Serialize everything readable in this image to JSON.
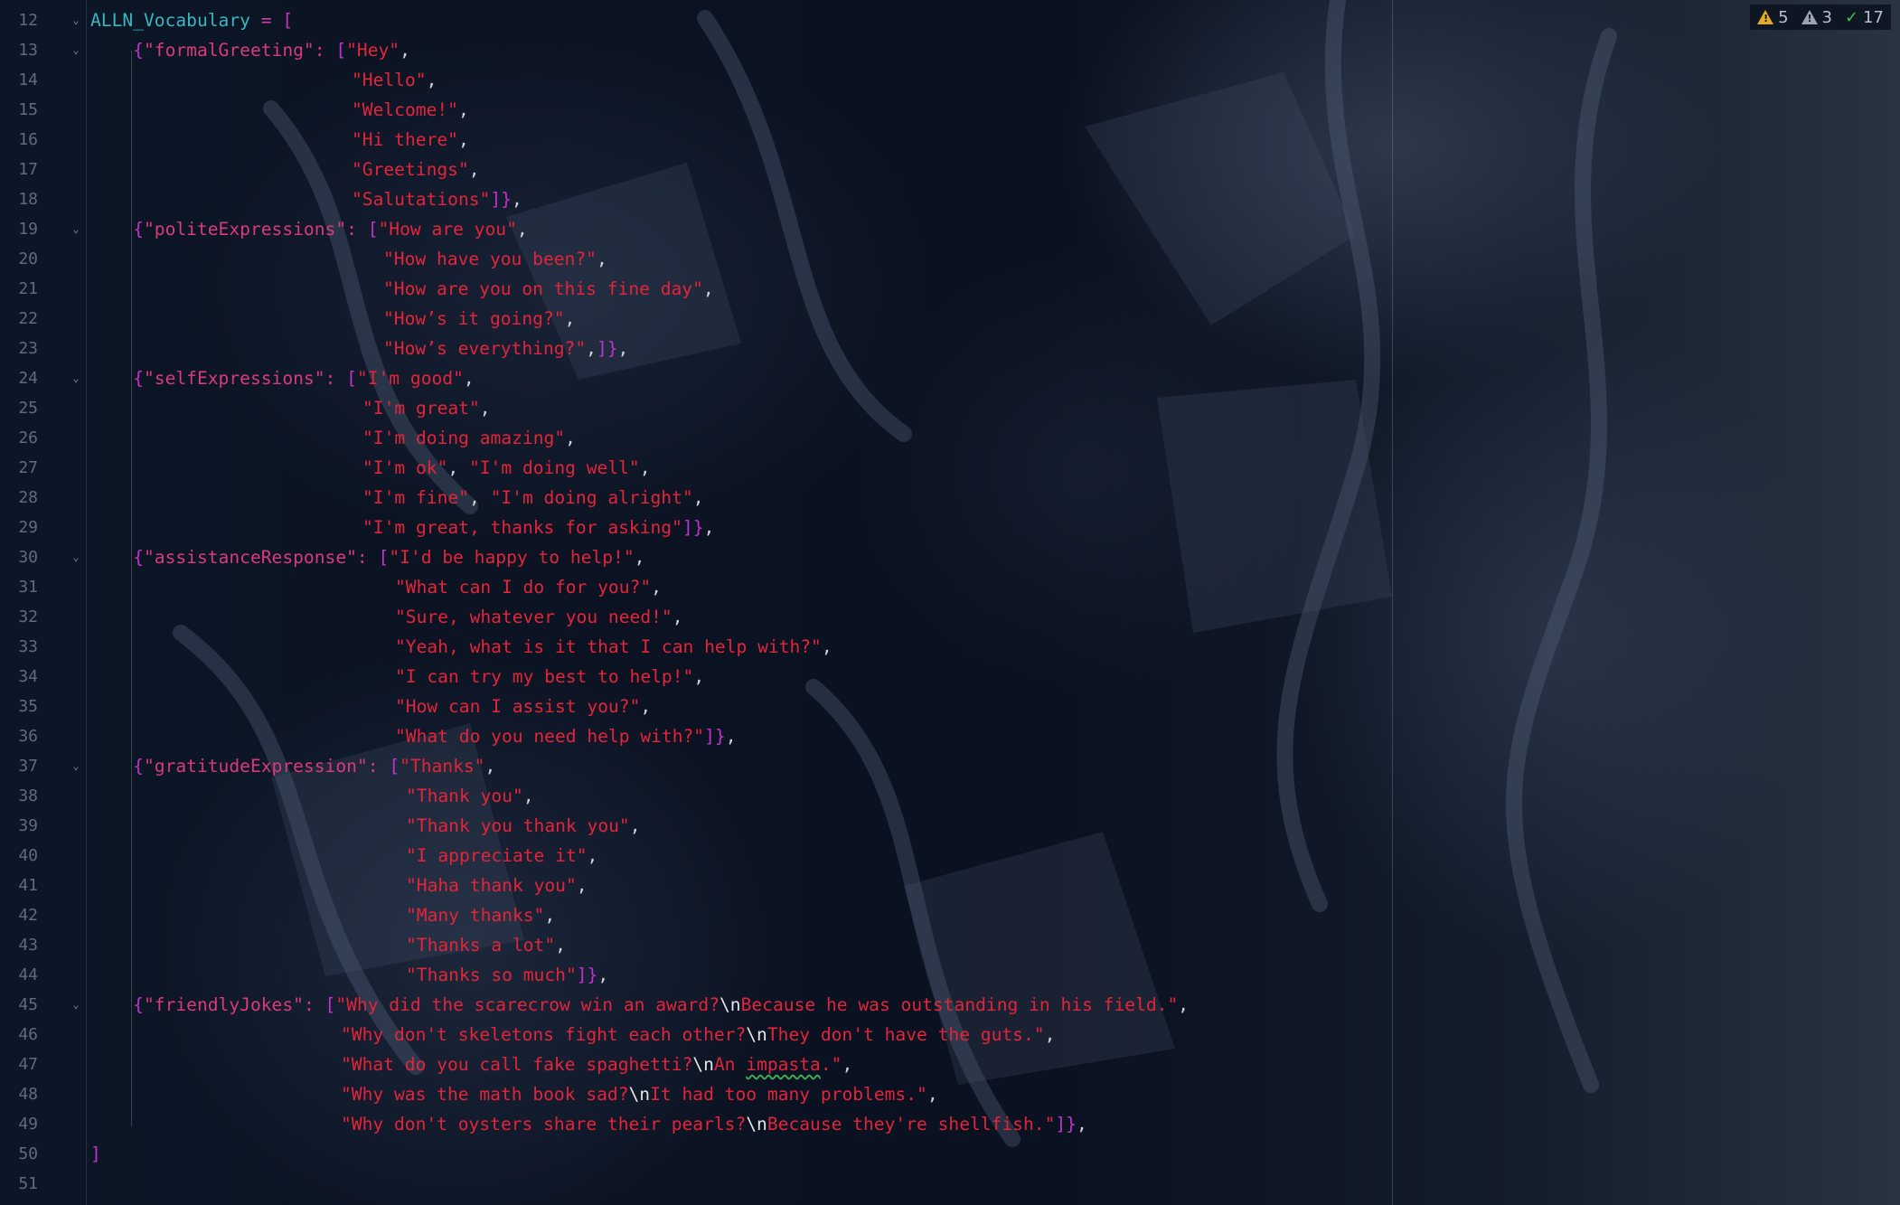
{
  "editor": {
    "inspections": {
      "warnings": "5",
      "weak_warnings": "3",
      "typos": "17",
      "colors": {
        "warning": "#e3a92a",
        "weak_warning": "#9aa3b0",
        "typo": "#3fbf5a"
      }
    },
    "line_numbers": [
      "12",
      "13",
      "14",
      "15",
      "16",
      "17",
      "18",
      "19",
      "20",
      "21",
      "22",
      "23",
      "24",
      "25",
      "26",
      "27",
      "28",
      "29",
      "30",
      "31",
      "32",
      "33",
      "34",
      "35",
      "36",
      "37",
      "38",
      "39",
      "40",
      "41",
      "42",
      "43",
      "44",
      "45",
      "46",
      "47",
      "48",
      "49",
      "50",
      "51"
    ],
    "fold_lines": [
      "12",
      "13",
      "19",
      "24",
      "30",
      "37",
      "45"
    ],
    "code": {
      "l12": {
        "var": "ALLN_Vocabulary",
        "op": " = ",
        "br": "["
      },
      "l13": {
        "open": "{",
        "key": "\"formalGreeting\"",
        "colon": ": ",
        "lbr": "[",
        "str": "\"Hey\"",
        "tail": ","
      },
      "l14": {
        "str": "\"Hello\"",
        "tail": ","
      },
      "l15": {
        "str": "\"Welcome!\"",
        "tail": ","
      },
      "l16": {
        "str": "\"Hi there\"",
        "tail": ","
      },
      "l17": {
        "str": "\"Greetings\"",
        "tail": ","
      },
      "l18": {
        "str": "\"Salutations\"",
        "close": "]}",
        "tail": ","
      },
      "l19": {
        "open": "{",
        "key": "\"politeExpressions\"",
        "colon": ": ",
        "lbr": "[",
        "str": "\"How are you\"",
        "tail": ","
      },
      "l20": {
        "str": "\"How have you been?\"",
        "tail": ","
      },
      "l21": {
        "str": "\"How are you on this fine day\"",
        "tail": ","
      },
      "l22": {
        "str": "\"How’s it going?\"",
        "tail": ","
      },
      "l23": {
        "str": "\"How’s everything?\"",
        "mid": ",",
        "close": "]}",
        "tail": ","
      },
      "l24": {
        "open": "{",
        "key": "\"selfExpressions\"",
        "colon": ": ",
        "lbr": "[",
        "str": "\"I'm good\"",
        "tail": ","
      },
      "l25": {
        "str": "\"I'm great\"",
        "tail": ","
      },
      "l26": {
        "str": "\"I'm doing amazing\"",
        "tail": ","
      },
      "l27": {
        "str": "\"I'm ok\"",
        "mid": ", ",
        "str2": "\"I'm doing well\"",
        "tail": ","
      },
      "l28": {
        "str": "\"I'm fine\"",
        "mid": ", ",
        "str2": "\"I'm doing alright\"",
        "tail": ","
      },
      "l29": {
        "str": "\"I'm great, thanks for asking\"",
        "close": "]}",
        "tail": ","
      },
      "l30": {
        "open": "{",
        "key": "\"assistanceResponse\"",
        "colon": ": ",
        "lbr": "[",
        "str": "\"I'd be happy to help!\"",
        "tail": ","
      },
      "l31": {
        "str": "\"What can I do for you?\"",
        "tail": ","
      },
      "l32": {
        "str": "\"Sure, whatever you need!\"",
        "tail": ","
      },
      "l33": {
        "str": "\"Yeah, what is it that I can help with?\"",
        "tail": ","
      },
      "l34": {
        "str": "\"I can try my best to help!\"",
        "tail": ","
      },
      "l35": {
        "str": "\"How can I assist you?\"",
        "tail": ","
      },
      "l36": {
        "str": "\"What do you need help with?\"",
        "close": "]}",
        "tail": ","
      },
      "l37": {
        "open": "{",
        "key": "\"gratitudeExpression\"",
        "colon": ": ",
        "lbr": "[",
        "str": "\"Thanks\"",
        "tail": ","
      },
      "l38": {
        "str": "\"Thank you\"",
        "tail": ","
      },
      "l39": {
        "str": "\"Thank you thank you\"",
        "tail": ","
      },
      "l40": {
        "str": "\"I appreciate it\"",
        "tail": ","
      },
      "l41": {
        "str": "\"Haha thank you\"",
        "tail": ","
      },
      "l42": {
        "str": "\"Many thanks\"",
        "tail": ","
      },
      "l43": {
        "str": "\"Thanks a lot\"",
        "tail": ","
      },
      "l44": {
        "str": "\"Thanks so much\"",
        "close": "]}",
        "tail": ","
      },
      "l45": {
        "open": "{",
        "key": "\"friendlyJokes\"",
        "colon": ": ",
        "lbr": "[",
        "s1": "\"Why did the scarecrow win an award?",
        "esc": "\\n",
        "s2": "Because he was outstanding in his field.\"",
        "tail": ","
      },
      "l46": {
        "s1": "\"Why don't skeletons fight each other?",
        "esc": "\\n",
        "s2": "They don't have the guts.\"",
        "tail": ","
      },
      "l47": {
        "s1": "\"What do you call fake spaghetti?",
        "esc": "\\n",
        "s2a": "An ",
        "typo": "impasta",
        "s2b": ".\"",
        "tail": ","
      },
      "l48": {
        "s1": "\"Why was the math book sad?",
        "esc": "\\n",
        "s2": "It had too many problems.\"",
        "tail": ","
      },
      "l49": {
        "s1": "\"Why don't oysters share their pearls?",
        "esc": "\\n",
        "s2": "Because they're shellfish.\"",
        "close": "]}",
        "tail": ","
      },
      "l50": {
        "br": "]"
      },
      "l51": {}
    }
  }
}
